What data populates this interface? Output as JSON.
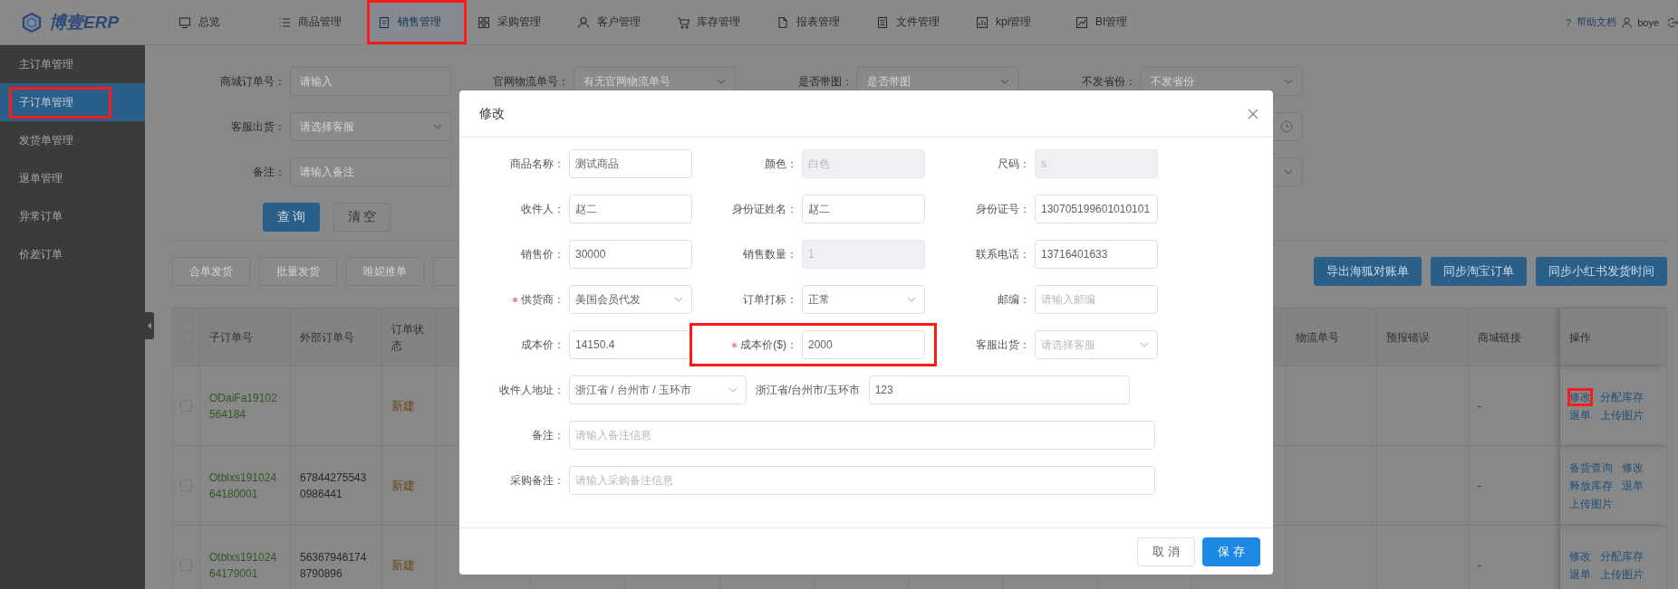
{
  "top_nav": {
    "logo": "博壹ERP",
    "items": [
      {
        "label": "总览",
        "selected": false,
        "highlighted": false
      },
      {
        "label": "商品管理",
        "selected": false,
        "highlighted": false
      },
      {
        "label": "销售管理",
        "selected": true,
        "highlighted": true
      },
      {
        "label": "采购管理",
        "selected": false,
        "highlighted": false
      },
      {
        "label": "客户管理",
        "selected": false,
        "highlighted": false
      },
      {
        "label": "库存管理",
        "selected": false,
        "highlighted": false
      },
      {
        "label": "报表管理",
        "selected": false,
        "highlighted": false
      },
      {
        "label": "文件管理",
        "selected": false,
        "highlighted": false
      },
      {
        "label": "kpi管理",
        "selected": false,
        "highlighted": false
      },
      {
        "label": "BI管理",
        "selected": false,
        "highlighted": false
      }
    ],
    "help_glyph": "?",
    "help": "帮助文档",
    "user": "boye"
  },
  "sidebar": {
    "items": [
      {
        "label": "主订单管理",
        "selected": false,
        "highlighted": false
      },
      {
        "label": "子订单管理",
        "selected": true,
        "highlighted": true
      },
      {
        "label": "发货单管理",
        "selected": false,
        "highlighted": false
      },
      {
        "label": "退单管理",
        "selected": false,
        "highlighted": false
      },
      {
        "label": "异常订单",
        "selected": false,
        "highlighted": false
      },
      {
        "label": "价差订单",
        "selected": false,
        "highlighted": false
      }
    ]
  },
  "filters": [
    [
      {
        "label": "商城订单号：",
        "placeholder": "请输入",
        "kind": "input"
      },
      {
        "label": "官网物流单号：",
        "placeholder": "有无官网物流单号",
        "kind": "select"
      },
      {
        "label": "是否带图：",
        "placeholder": "是否带图",
        "kind": "select"
      },
      {
        "label": "不发省份：",
        "placeholder": "不发省份",
        "kind": "select"
      }
    ],
    [
      {
        "label": "客服出货：",
        "placeholder": "请选择客服",
        "kind": "select"
      }
    ],
    [
      {
        "label": "备注：",
        "placeholder": "请输入备注",
        "kind": "input"
      }
    ]
  ],
  "query_buttons": [
    {
      "label": "查 询",
      "kind": "primary"
    },
    {
      "label": "清 空",
      "kind": "default"
    }
  ],
  "action_buttons_left": [
    "合单发货",
    "批量发货",
    "唯妮推单"
  ],
  "action_buttons_right": [
    "导出海狐对账单",
    "同步淘宝订单",
    "同步小红书发货时间"
  ],
  "table": {
    "select_all_checked": false,
    "columns_left": [
      "子订单号",
      "外部订单号",
      "订单状态"
    ],
    "columns_right": [
      "物流单号",
      "预报错误",
      "商城链接",
      "操作"
    ],
    "rows": [
      {
        "checked": false,
        "sub_order_no": "ODaiFa19102564184",
        "status": "新建",
        "mall_link": "-",
        "actions": [
          {
            "label": "修改",
            "highlighted": true
          },
          {
            "label": "分配库存",
            "highlighted": false
          },
          {
            "label": "退单",
            "highlighted": false
          },
          {
            "label": "上传图片",
            "highlighted": false
          }
        ]
      },
      {
        "checked": false,
        "sub_order_no": "Otblxs19102464180001",
        "external_order_no": "678442755430986441",
        "status": "新建",
        "mall_link": "-",
        "actions": [
          {
            "label": "备货查询",
            "highlighted": false
          },
          {
            "label": "修改",
            "highlighted": false
          },
          {
            "label": "释放库存",
            "highlighted": false
          },
          {
            "label": "退单",
            "highlighted": false
          },
          {
            "label": "上传图片",
            "highlighted": false
          }
        ]
      },
      {
        "checked": false,
        "sub_order_no": "Otblxs19102464179001",
        "external_order_no": "563679461748790896",
        "status": "新建",
        "mall_link": "-",
        "actions": [
          {
            "label": "修改",
            "highlighted": false
          },
          {
            "label": "分配库存",
            "highlighted": false
          },
          {
            "label": "退单",
            "highlighted": false
          },
          {
            "label": "上传图片",
            "highlighted": false
          }
        ]
      }
    ]
  },
  "modal": {
    "title": "修改",
    "fields": [
      {
        "label": "商品名称：",
        "value": "测试商品",
        "kind": "input",
        "disabled": false,
        "required": false,
        "highlighted": false
      },
      {
        "label": "颜色：",
        "value": "白色",
        "kind": "input",
        "disabled": true,
        "required": false,
        "highlighted": false
      },
      {
        "label": "尺码：",
        "value": "s",
        "kind": "input",
        "disabled": true,
        "required": false,
        "highlighted": false
      },
      {
        "label": "收件人：",
        "value": "赵二",
        "kind": "input",
        "disabled": false,
        "required": false,
        "highlighted": false
      },
      {
        "label": "身份证姓名：",
        "value": "赵二",
        "kind": "input",
        "disabled": false,
        "required": false,
        "highlighted": false
      },
      {
        "label": "身份证号：",
        "value": "130705199601010101",
        "kind": "input",
        "disabled": false,
        "required": false,
        "highlighted": false
      },
      {
        "label": "销售价：",
        "value": "30000",
        "kind": "input",
        "disabled": false,
        "required": false,
        "highlighted": false
      },
      {
        "label": "销售数量：",
        "value": "1",
        "kind": "input",
        "disabled": true,
        "required": false,
        "highlighted": false
      },
      {
        "label": "联系电话：",
        "value": "13716401633",
        "kind": "input",
        "disabled": false,
        "required": false,
        "highlighted": false
      },
      {
        "label": "供货商：",
        "value": "美国会员代发",
        "kind": "select",
        "disabled": false,
        "required": true,
        "highlighted": false
      },
      {
        "label": "订单打标：",
        "value": "正常",
        "kind": "select",
        "disabled": false,
        "required": false,
        "highlighted": false
      },
      {
        "label": "邮编：",
        "placeholder": "请输入邮编",
        "kind": "input",
        "disabled": false,
        "required": false,
        "highlighted": false
      },
      {
        "label": "成本价：",
        "value": "14150.4",
        "kind": "input",
        "disabled": false,
        "required": false,
        "highlighted": false
      },
      {
        "label": "成本价($)：",
        "value": "2000",
        "kind": "input",
        "disabled": false,
        "required": true,
        "highlighted": true
      },
      {
        "label": "客服出货：",
        "placeholder": "请选择客服",
        "kind": "select",
        "disabled": false,
        "required": false,
        "highlighted": false
      }
    ],
    "address": {
      "label": "收件人地址：",
      "region": "浙江省 / 台州市 / 玉环市",
      "region_text": "浙江省/台州市/玉环市",
      "detail": "123"
    },
    "remarks": [
      {
        "label": "备注：",
        "placeholder": "请输入备注信息"
      },
      {
        "label": "采购备注：",
        "placeholder": "请输入采购备注信息"
      }
    ],
    "buttons": [
      {
        "label": "取 消",
        "kind": "default"
      },
      {
        "label": "保 存",
        "kind": "primary"
      }
    ]
  }
}
